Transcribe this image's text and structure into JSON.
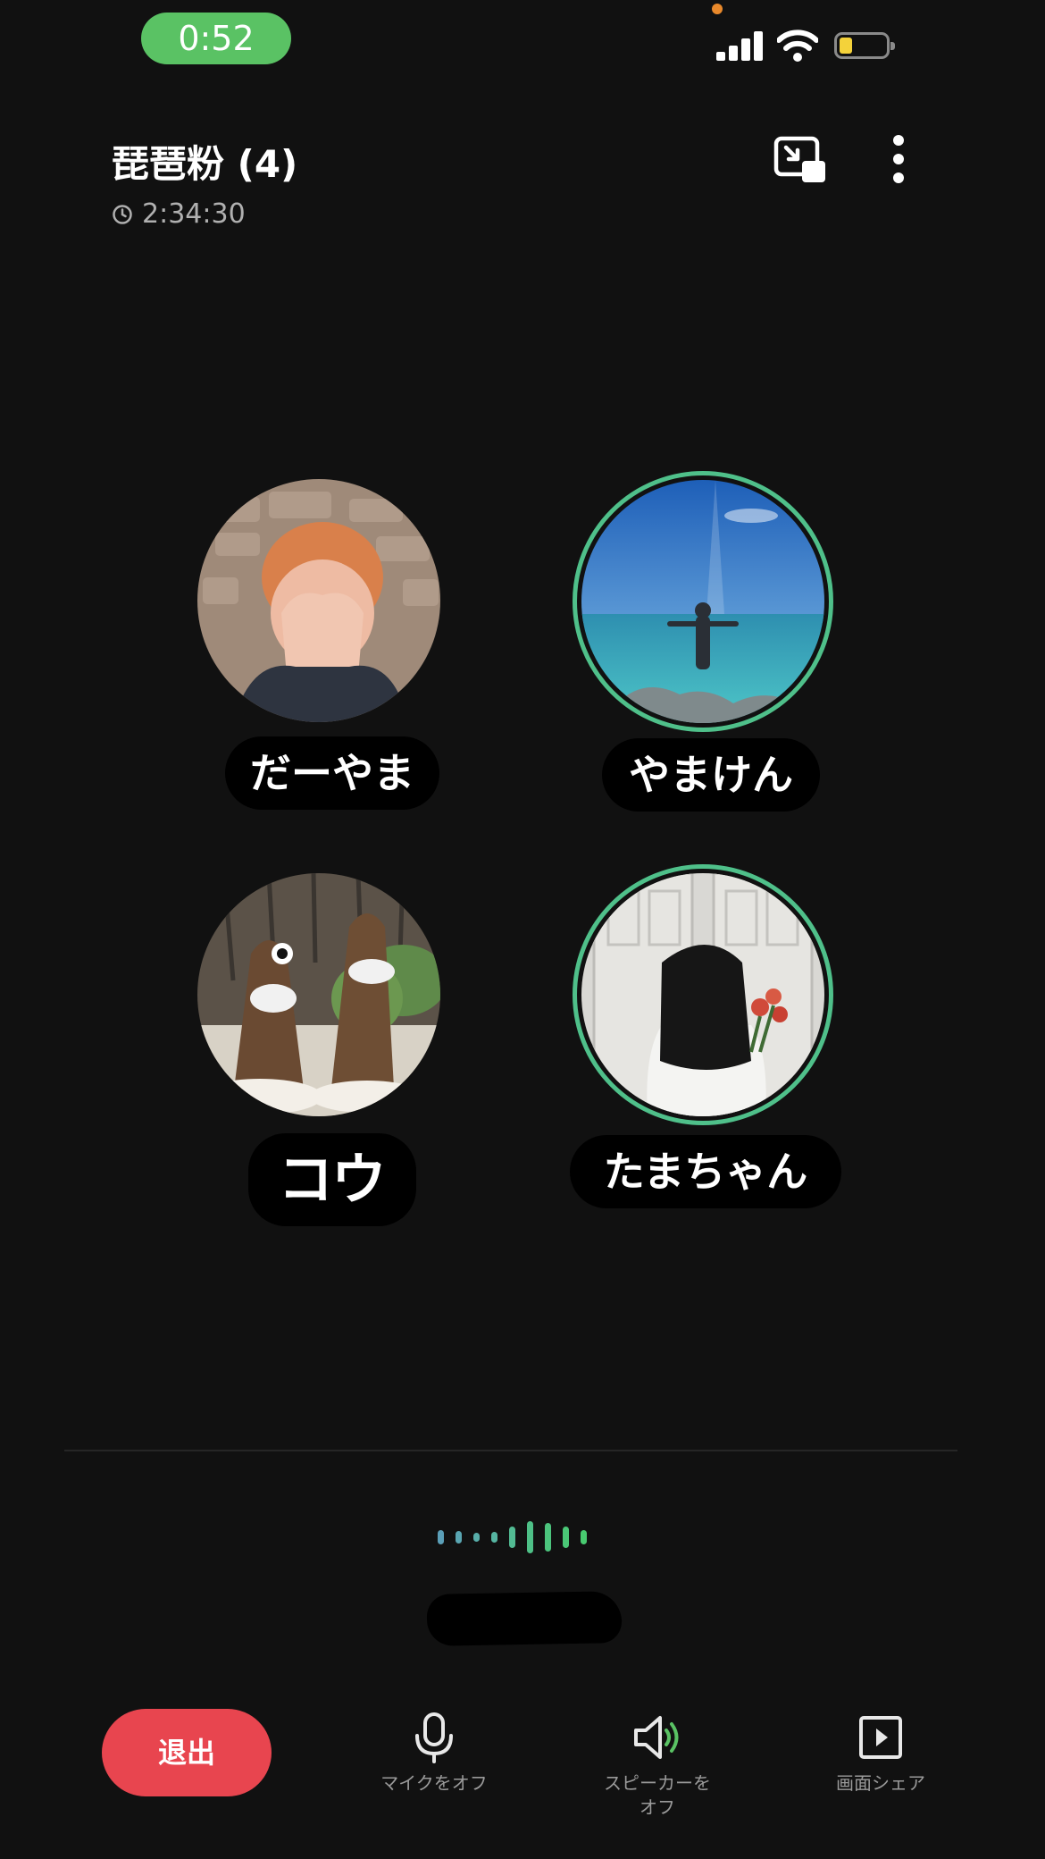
{
  "status_bar": {
    "time": "0:52"
  },
  "header": {
    "title": "琵琶粉 (4)",
    "duration": "2:34:30"
  },
  "participants": [
    {
      "name": "だーやま",
      "speaking": false
    },
    {
      "name": "やまけん",
      "speaking": true
    },
    {
      "name": "コウ",
      "speaking": false
    },
    {
      "name": "たまちゃん",
      "speaking": true
    }
  ],
  "controls": {
    "leave_label": "退出",
    "mic_label": "マイクをオフ",
    "speaker_label_line1": "スピーカーを",
    "speaker_label_line2": "オフ",
    "share_label": "画面シェア"
  },
  "icons": {
    "clock": "clock-icon",
    "pip": "picture-in-picture-icon",
    "more": "more-vertical-icon",
    "mic": "microphone-icon",
    "speaker": "speaker-icon",
    "share": "screen-share-icon"
  },
  "colors": {
    "background": "#111111",
    "accent_green": "#5ac264",
    "speaking_ring": "#4fc08a",
    "leave_red": "#e8454f"
  }
}
